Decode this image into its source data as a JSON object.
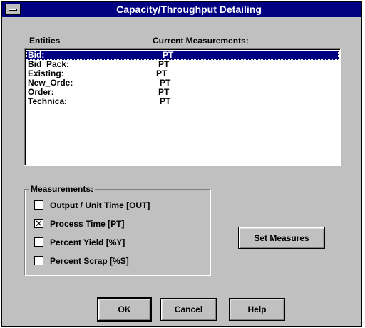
{
  "window": {
    "title": "Capacity/Throughput Detailing"
  },
  "headers": {
    "entities": "Entities",
    "measurements": "Current Measurements:"
  },
  "list": [
    {
      "entity": "Bid:",
      "value": "PT",
      "selected": true
    },
    {
      "entity": "Bid_Pack:",
      "value": "PT"
    },
    {
      "entity": "Existing:",
      "value": "PT"
    },
    {
      "entity": "New_Orde:",
      "value": "PT"
    },
    {
      "entity": "Order:",
      "value": "PT"
    },
    {
      "entity": "Technica:",
      "value": "PT"
    }
  ],
  "measurements": {
    "title": "Measurements:",
    "options": [
      {
        "label": "Output / Unit Time [OUT]",
        "checked": false
      },
      {
        "label": "Process Time [PT]",
        "checked": true
      },
      {
        "label": "Percent Yield [%Y]",
        "checked": false
      },
      {
        "label": "Percent Scrap [%S]",
        "checked": false
      }
    ]
  },
  "buttons": {
    "set_measures": "Set Measures",
    "ok": "OK",
    "cancel": "Cancel",
    "help": "Help"
  }
}
